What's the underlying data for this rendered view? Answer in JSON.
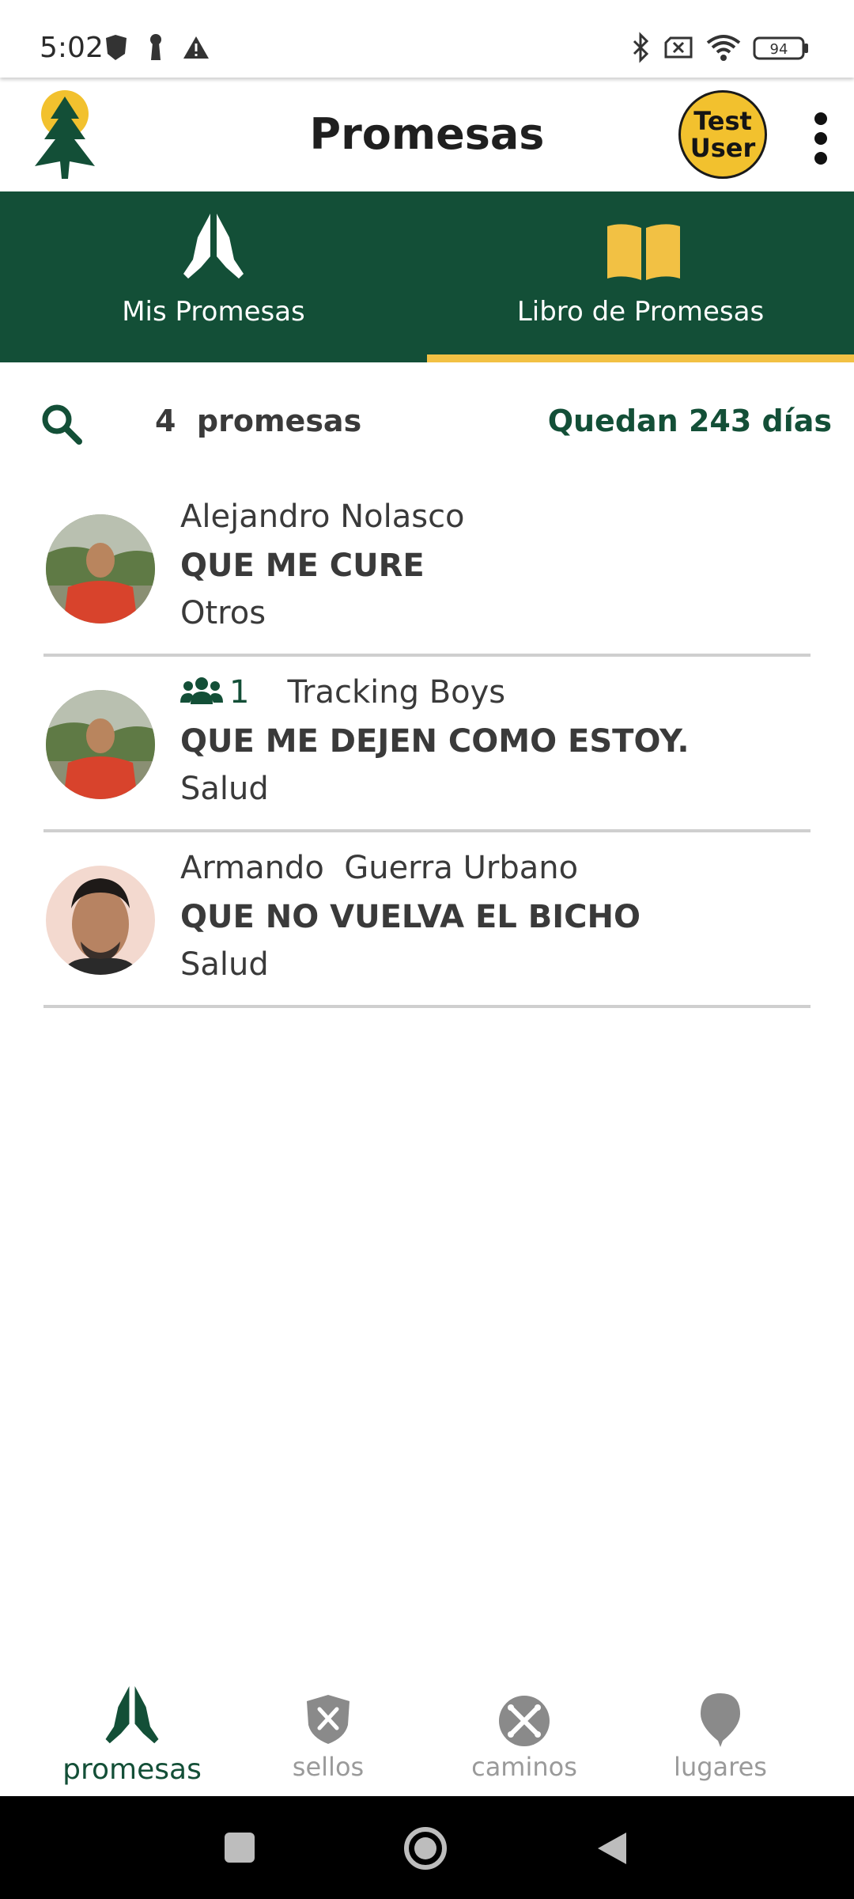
{
  "status_bar": {
    "time": "5:02",
    "battery": "94"
  },
  "app_bar": {
    "title": "Promesas",
    "user_badge": {
      "line1": "Test",
      "line2": "User"
    }
  },
  "tabs": [
    {
      "label": "Mis Promesas",
      "icon": "praying-hands-icon",
      "active": false
    },
    {
      "label": "Libro de Promesas",
      "icon": "open-book-icon",
      "active": true
    }
  ],
  "summary": {
    "count_text": "4  promesas",
    "remaining_text": "Quedan 243 días"
  },
  "promises": [
    {
      "author": "Alejandro Nolasco",
      "text": "QUE ME CURE",
      "category": "Otros"
    },
    {
      "group_count": "1",
      "group_name": "Tracking Boys",
      "text": "QUE ME DEJEN COMO ESTOY.",
      "category": "Salud"
    },
    {
      "author": "Armando  Guerra Urbano",
      "text": "QUE NO VUELVA EL BICHO",
      "category": "Salud"
    }
  ],
  "bottom_nav": [
    {
      "label": "promesas",
      "icon": "praying-hands-icon",
      "active": true
    },
    {
      "label": "sellos",
      "icon": "shield-icon",
      "active": false
    },
    {
      "label": "caminos",
      "icon": "crossed-bones-icon",
      "active": false
    },
    {
      "label": "lugares",
      "icon": "map-pin-icon",
      "active": false
    }
  ],
  "colors": {
    "primary": "#134f37",
    "accent": "#f2c144",
    "text": "#3a3a3a"
  }
}
